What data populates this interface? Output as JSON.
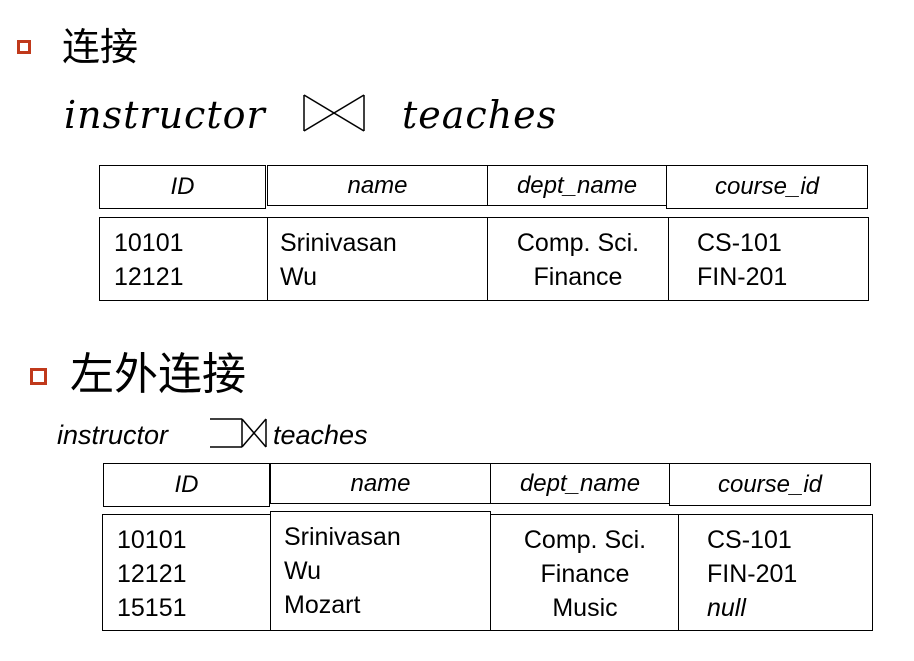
{
  "section1": {
    "title": "连接",
    "expr": {
      "left": "instructor",
      "right": "teaches"
    },
    "table": {
      "headers": [
        "ID",
        "name",
        "dept_name",
        "course_id"
      ],
      "columns": [
        [
          "10101",
          "12121"
        ],
        [
          "Srinivasan",
          "Wu"
        ],
        [
          "Comp. Sci.",
          "Finance"
        ],
        [
          "CS-101",
          "FIN-201"
        ]
      ]
    }
  },
  "section2": {
    "title": "左外连接",
    "expr": {
      "left": "instructor",
      "right": "teaches"
    },
    "table": {
      "headers": [
        "ID",
        "name",
        "dept_name",
        "course_id"
      ],
      "columns": [
        [
          "10101",
          "12121",
          "15151"
        ],
        [
          "Srinivasan",
          "Wu",
          "Mozart"
        ],
        [
          "Comp. Sci.",
          "Finance",
          "Music"
        ],
        [
          "CS-101",
          "FIN-201",
          "null"
        ]
      ]
    }
  },
  "colors": {
    "bullet": "#c0391b",
    "text": "#000000",
    "background": "#ffffff"
  }
}
